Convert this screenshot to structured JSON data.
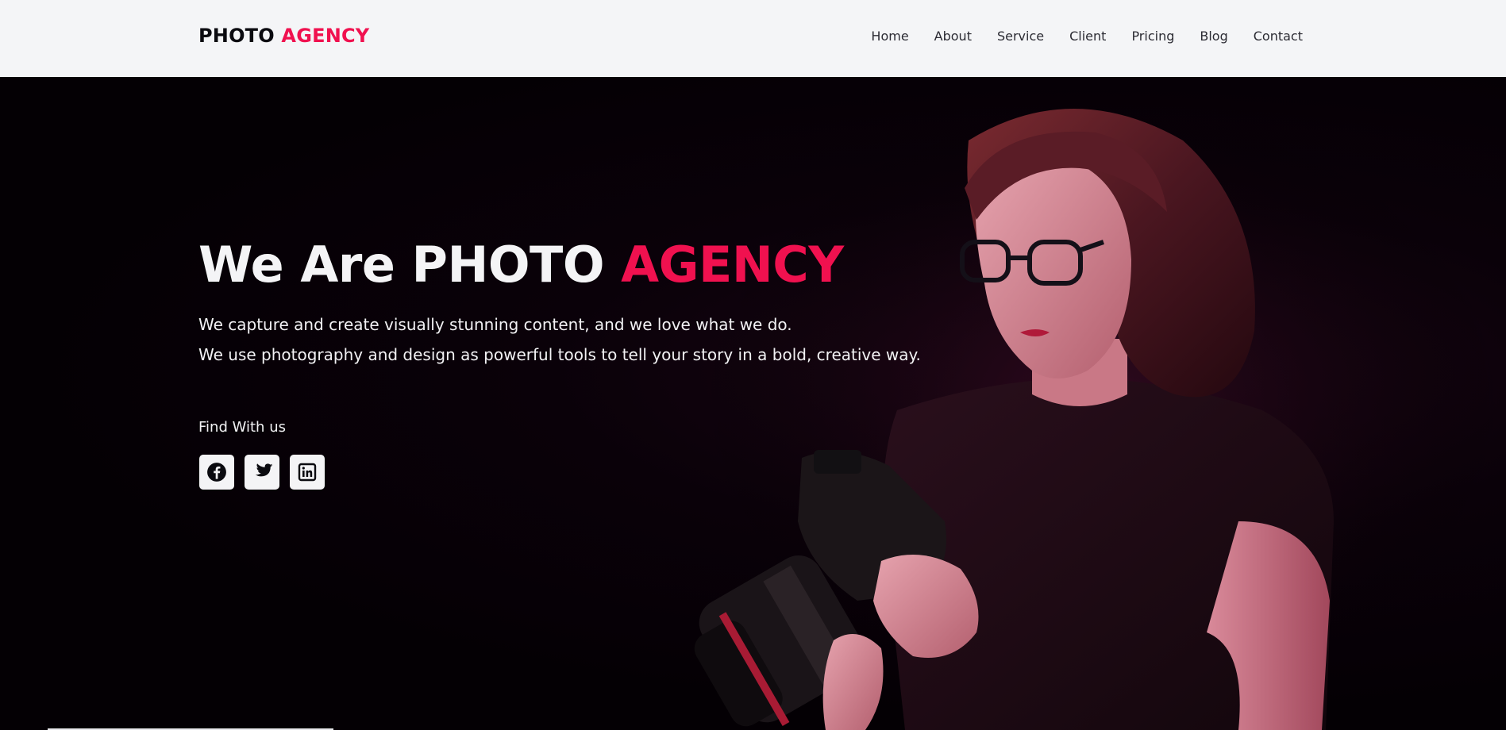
{
  "brand": {
    "part1": "PHOTO",
    "part2": "AGENCY"
  },
  "nav": {
    "items": [
      "Home",
      "About",
      "Service",
      "Client",
      "Pricing",
      "Blog",
      "Contact"
    ]
  },
  "hero": {
    "title_part1": "We Are PHOTO",
    "title_part2": "AGENCY",
    "line1": "We capture and create visually stunning content, and we love what we do.",
    "line2": "We use photography and design as powerful tools to tell your story in a bold, creative way.",
    "find_label": "Find With us"
  },
  "socials": {
    "icons": [
      "facebook-icon",
      "twitter-icon",
      "linkedin-icon"
    ]
  },
  "colors": {
    "accent": "#f0114f",
    "navbar_bg": "#f4f5f7",
    "hero_bg": "#050005",
    "text_light": "#f2f2f4"
  }
}
